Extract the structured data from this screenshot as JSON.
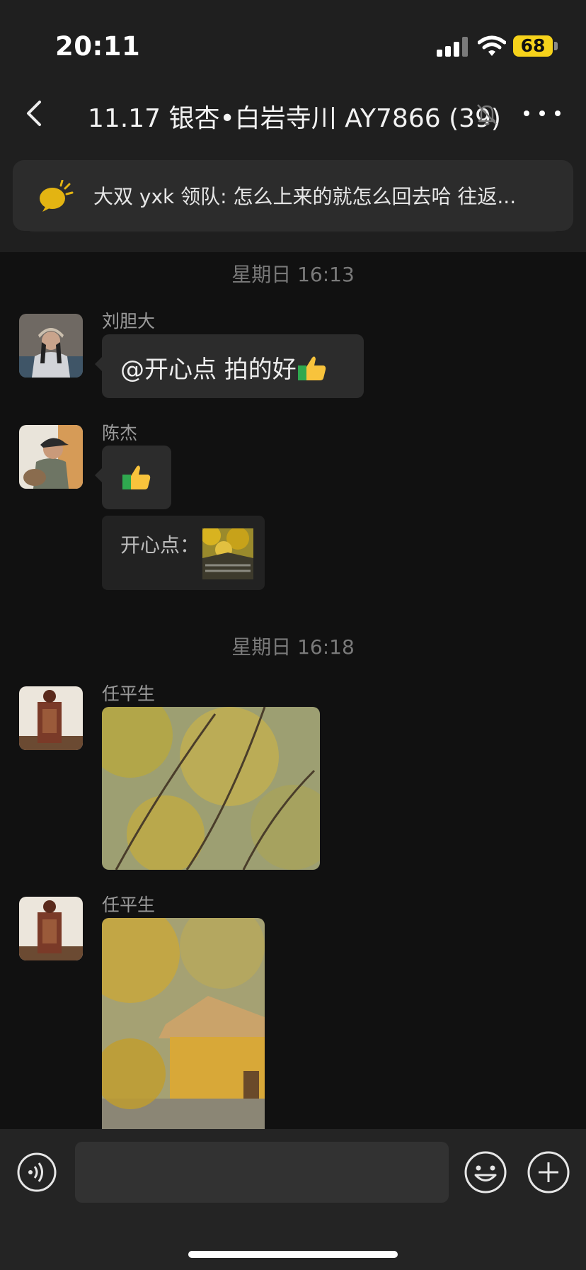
{
  "status_bar": {
    "time": "20:11",
    "battery": "68"
  },
  "header": {
    "title": "11.17 银杏•白岩寺川 AY7866 (39)"
  },
  "notice": {
    "text": "大双 yxk 领队: 怎么上来的就怎么回去哈 往返..."
  },
  "messages": {
    "ts1": "星期日 16:13",
    "m1": {
      "sender": "刘胆大",
      "text": "@开心点 拍的好"
    },
    "m2": {
      "sender": "陈杰",
      "quote": "开心点："
    },
    "ts2": "星期日 16:18",
    "m3": {
      "sender": "任平生"
    },
    "m4": {
      "sender": "任平生"
    }
  },
  "colors": {
    "accent_yellow": "#f6d21b",
    "bubble": "#2c2c2c",
    "background": "#111111"
  },
  "icons": [
    "back-icon",
    "mute-bell-icon",
    "more-icon",
    "announcement-icon",
    "thumbs-up-icon",
    "voice-icon",
    "emoji-icon",
    "plus-icon"
  ]
}
